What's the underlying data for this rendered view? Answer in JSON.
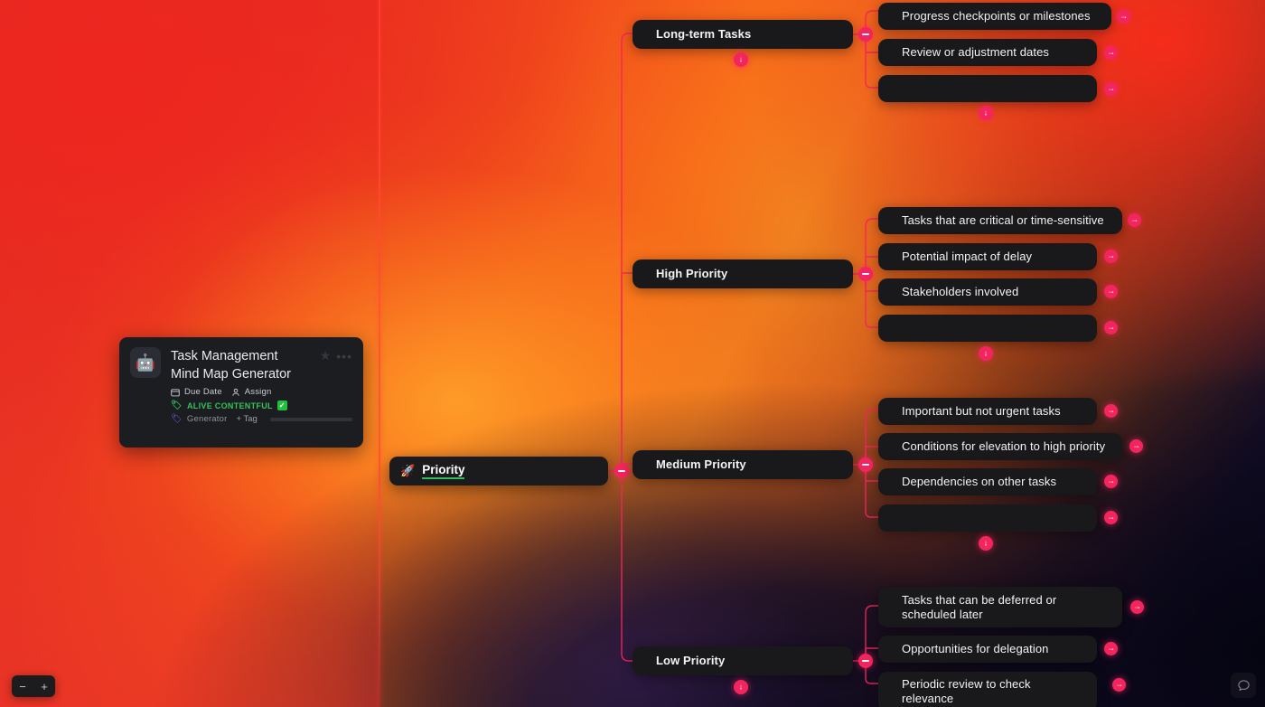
{
  "card": {
    "emoji": "🤖",
    "title": "Task Management\nMind Map Generator",
    "title_line1": "Task Management",
    "title_line2": "Mind Map Generator",
    "star_icon": "star-icon",
    "more_icon": "ellipsis-icon",
    "due_date_label": "Due Date",
    "assign_label": "Assign",
    "status_tag": "ALIVE CONTENTFUL",
    "status_check": "✓",
    "category_tag": "Generator",
    "add_tag_label": "+ Tag",
    "progress_percent": 0
  },
  "root": {
    "emoji": "🚀",
    "label": "Priority"
  },
  "branches": [
    {
      "label": "Long-term Tasks",
      "collapse_icon": "minus-icon",
      "expand_down_icon": "arrow-down-icon",
      "children": [
        {
          "label": "Progress checkpoints or milestones",
          "action_icon": "arrow-right-icon"
        },
        {
          "label": "Review or adjustment dates",
          "action_icon": "arrow-right-icon"
        },
        {
          "label": "",
          "action_icon": "arrow-right-icon"
        }
      ],
      "children_down_icon": "arrow-down-icon"
    },
    {
      "label": "High Priority",
      "collapse_icon": "minus-icon",
      "children": [
        {
          "label": "Tasks that are critical or time-sensitive",
          "action_icon": "arrow-right-icon"
        },
        {
          "label": "Potential impact of delay",
          "action_icon": "arrow-right-icon"
        },
        {
          "label": "Stakeholders involved",
          "action_icon": "arrow-right-icon"
        },
        {
          "label": "",
          "action_icon": "arrow-right-icon"
        }
      ],
      "children_down_icon": "arrow-down-icon"
    },
    {
      "label": "Medium Priority",
      "collapse_icon": "minus-icon",
      "children": [
        {
          "label": "Important but not urgent tasks",
          "action_icon": "arrow-right-icon"
        },
        {
          "label": "Conditions for elevation to high priority",
          "action_icon": "arrow-right-icon"
        },
        {
          "label": "Dependencies on other tasks",
          "action_icon": "arrow-right-icon"
        },
        {
          "label": "",
          "action_icon": "arrow-right-icon"
        }
      ],
      "children_down_icon": "arrow-down-icon"
    },
    {
      "label": "Low Priority",
      "collapse_icon": "minus-icon",
      "expand_down_icon": "arrow-down-icon",
      "children": [
        {
          "label": "Tasks that can be deferred or scheduled later",
          "action_icon": "arrow-right-icon"
        },
        {
          "label": "Opportunities for delegation",
          "action_icon": "arrow-right-icon"
        },
        {
          "label": "Periodic review to check relevance",
          "action_icon": "arrow-right-icon"
        }
      ]
    }
  ],
  "controls": {
    "zoom_out_label": "−",
    "zoom_in_label": "+",
    "chat_icon": "chat-bubble-icon",
    "arrow_down_glyph": "↓",
    "arrow_right_glyph": "→"
  },
  "colors": {
    "accent_pink": "#f4255e",
    "node_bg": "#19191b",
    "green_tag": "#36c15d",
    "purple_tag": "#7b5cf0",
    "bg_red": "#e8291f",
    "bg_orange": "#f8701a",
    "bg_dark": "#0a0a1c"
  }
}
